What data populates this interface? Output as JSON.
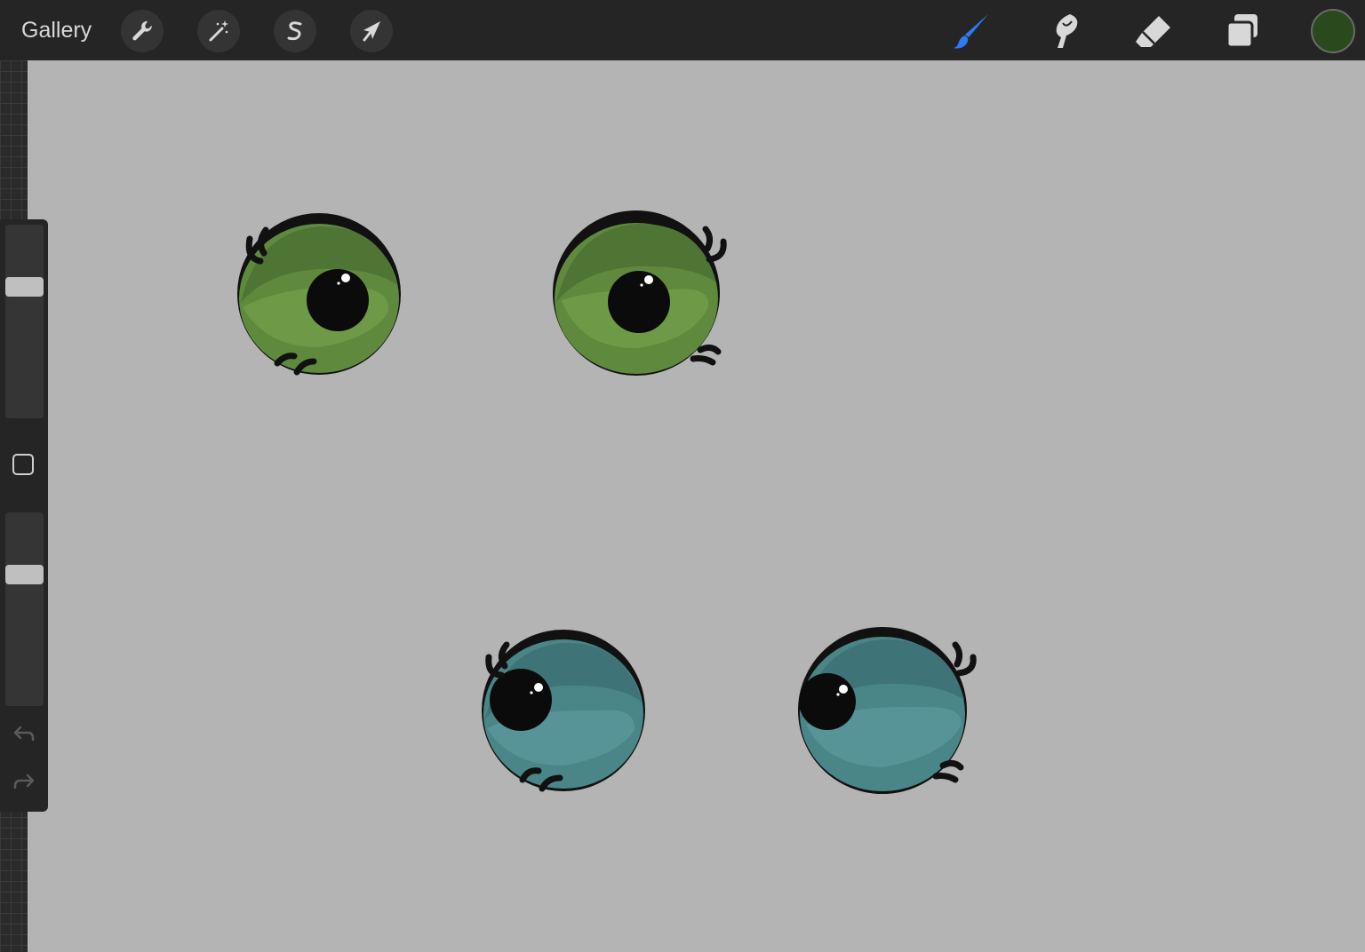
{
  "toolbar": {
    "gallery_label": "Gallery",
    "left_tools": [
      {
        "name": "adjustments",
        "icon": "wrench-icon"
      },
      {
        "name": "magic",
        "icon": "magic-wand-icon"
      },
      {
        "name": "selection",
        "icon": "selection-s-icon"
      },
      {
        "name": "transform",
        "icon": "arrow-cursor-icon"
      }
    ],
    "right_tools": [
      {
        "name": "brush",
        "icon": "brush-icon",
        "active": true
      },
      {
        "name": "smudge",
        "icon": "smudge-icon",
        "active": false
      },
      {
        "name": "eraser",
        "icon": "eraser-icon",
        "active": false
      },
      {
        "name": "layers",
        "icon": "layers-icon",
        "active": false
      }
    ],
    "current_color": "#2a4a1e",
    "active_tool_color": "#2f7bf5"
  },
  "sidebar": {
    "brush_size_level": 0.7,
    "opacity_level": 0.7,
    "modify_button_icon": "square-icon",
    "undo_icon": "undo-icon",
    "redo_icon": "redo-icon"
  },
  "canvas": {
    "background_color": "#b4b4b4",
    "artwork": [
      {
        "name": "green-eye-left",
        "iris": "#5f8a3e",
        "shade": "#4f7535",
        "highlight": "#6e9a48"
      },
      {
        "name": "green-eye-right",
        "iris": "#5f8a3e",
        "shade": "#4f7535",
        "highlight": "#6e9a48"
      },
      {
        "name": "teal-eye-left",
        "iris": "#4a8588",
        "shade": "#3e7478",
        "highlight": "#579497"
      },
      {
        "name": "teal-eye-right",
        "iris": "#4a8588",
        "shade": "#3e7478",
        "highlight": "#579497"
      }
    ]
  }
}
